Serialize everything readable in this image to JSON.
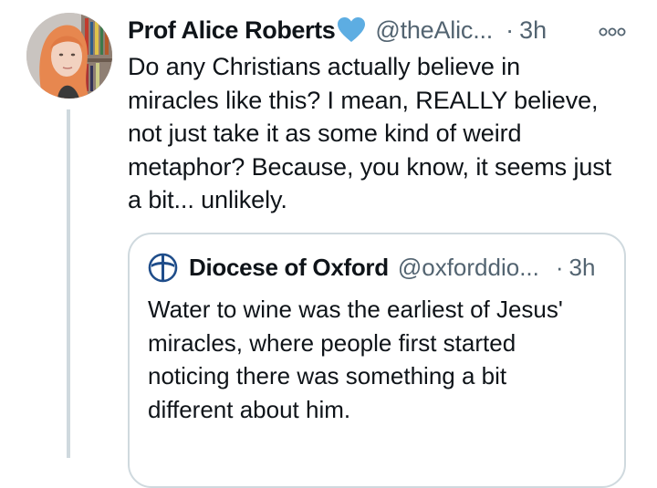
{
  "tweet": {
    "author_name": "Prof Alice Roberts",
    "author_emoji_icon": "blue-heart-icon",
    "handle": "@theAlic...",
    "separator": "·",
    "time": "3h",
    "more_icon": "more-options-icon",
    "text_lines": [
      "Do any Christians actually believe in",
      "miracles like this? I mean, REALLY believe,",
      "not just take it as some kind of weird",
      "metaphor? Because, you know, it seems just",
      "a bit... unlikely."
    ]
  },
  "quoted_tweet": {
    "avatar_icon": "diocese-cross-logo-icon",
    "author_name": "Diocese of Oxford",
    "handle": "@oxforddio...",
    "separator": "·",
    "time": "3h",
    "text_lines": [
      "Water to wine was the earliest of Jesus'",
      "miracles, where people first started",
      "noticing there was something a bit",
      "different about him."
    ]
  },
  "colors": {
    "text_primary": "#0f1419",
    "text_secondary": "#536471",
    "border": "#cfd9de",
    "heart": "#5dade2",
    "logo": "#1f4d8a"
  }
}
